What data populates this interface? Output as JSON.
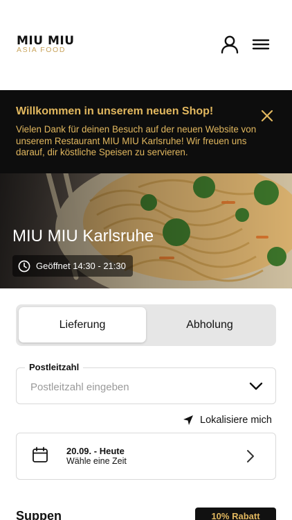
{
  "header": {
    "logo_main": "MIU MIU",
    "logo_sub": "ASIA FOOD",
    "user_icon": "user-icon",
    "menu_icon": "hamburger-menu-icon"
  },
  "banner": {
    "title": "Willkommen in unserem neuen Shop!",
    "text": "Vielen Dank für deinen Besuch auf der neuen Website von unserem Restaurant MIU MIU Karlsruhe! Wir freuen uns darauf, dir köstliche Speisen zu servieren.",
    "close_icon": "close-icon"
  },
  "hero": {
    "restaurant_name": "MIU MIU Karlsruhe",
    "hours": "Geöffnet 14:30 - 21:30",
    "clock_icon": "clock-icon"
  },
  "order_mode": {
    "options": [
      "Lieferung",
      "Abholung"
    ],
    "selected": "Lieferung"
  },
  "postcode": {
    "label": "Postleitzahl",
    "placeholder": "Postleitzahl eingeben"
  },
  "locate": {
    "label": "Lokalisiere mich",
    "icon": "location-arrow-icon"
  },
  "time_picker": {
    "date": "20.09. - Heute",
    "prompt": "Wähle eine Zeit"
  },
  "menu_section": {
    "title": "Suppen",
    "badge": "10% Rabatt"
  },
  "colors": {
    "gold_accent": "#e2b85f",
    "banner_bg": "#0d0d0d",
    "segment_bg": "#e6e6e6"
  }
}
